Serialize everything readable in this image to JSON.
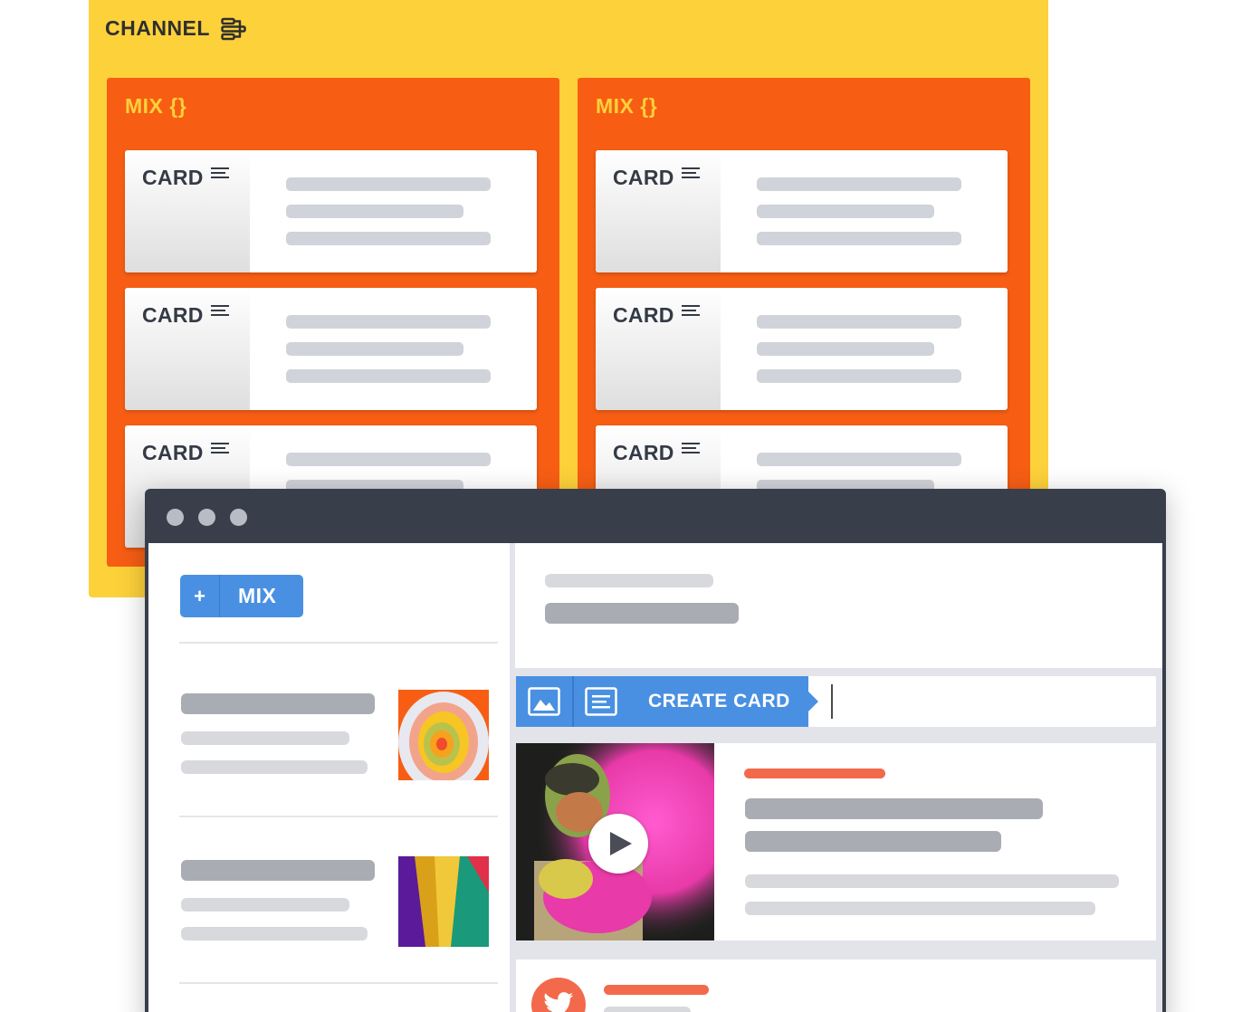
{
  "channel": {
    "title": "CHANNEL",
    "icon": "hierarchy-icon",
    "color": "#fdd13a"
  },
  "mixes": [
    {
      "title": "MIX {}",
      "cards": [
        {
          "label": "CARD"
        },
        {
          "label": "CARD"
        },
        {
          "label": "CARD"
        }
      ]
    },
    {
      "title": "MIX {}",
      "cards": [
        {
          "label": "CARD"
        },
        {
          "label": "CARD"
        },
        {
          "label": "CARD"
        }
      ]
    }
  ],
  "mix_color": "#f75e14",
  "window": {
    "sidebar": {
      "add_button": {
        "plus": "+",
        "label": "MIX"
      }
    },
    "composer": {
      "create_label": "CREATE CARD",
      "image_icon": "image-icon",
      "text_icon": "text-icon"
    },
    "feed": {
      "video_icon": "play-icon",
      "social_icon": "twitter-icon"
    }
  },
  "accent_colors": {
    "blue": "#4a90e2",
    "orange": "#f26a4b",
    "dark": "#393e4b"
  }
}
